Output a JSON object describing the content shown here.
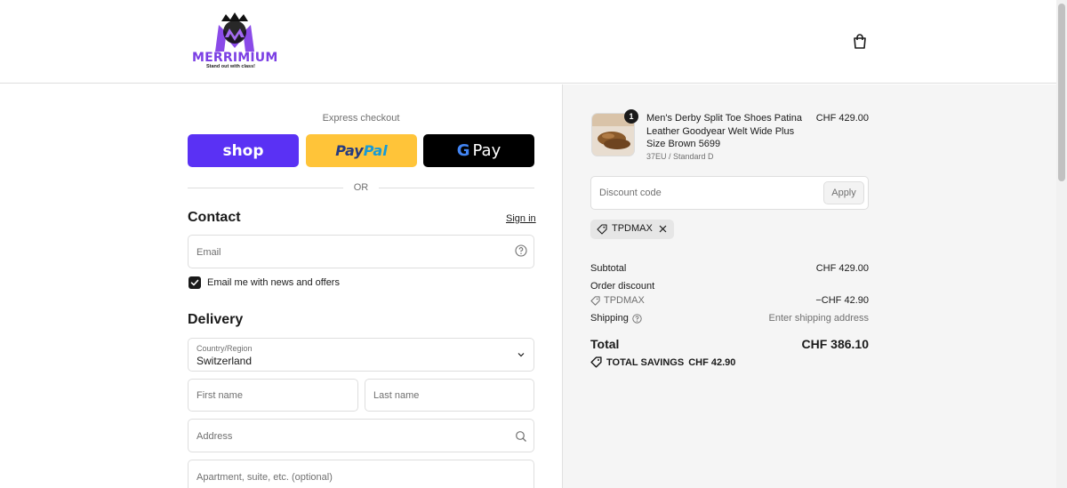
{
  "brand": {
    "name": "MERRIMIUM",
    "tagline": "Stand out with class!"
  },
  "express": {
    "label": "Express checkout",
    "shop_label": "shop",
    "paypal_part1": "Pay",
    "paypal_part2": "Pal",
    "gpay_g": "G",
    "gpay_label": "Pay",
    "or_label": "OR"
  },
  "contact": {
    "title": "Contact",
    "signin": "Sign in",
    "email_placeholder": "Email",
    "newsletter_label": "Email me with news and offers",
    "newsletter_checked": true
  },
  "delivery": {
    "title": "Delivery",
    "country_label": "Country/Region",
    "country_value": "Switzerland",
    "first_name_placeholder": "First name",
    "last_name_placeholder": "Last name",
    "address_placeholder": "Address",
    "apartment_placeholder": "Apartment, suite, etc. (optional)"
  },
  "summary": {
    "product": {
      "quantity": "1",
      "name": "Men's Derby Split Toe Shoes Patina Leather Goodyear Welt Wide Plus Size Brown 5699",
      "variant": "37EU / Standard D",
      "price": "CHF 429.00"
    },
    "discount_placeholder": "Discount code",
    "apply_label": "Apply",
    "applied_code": "TPDMAX",
    "subtotal_label": "Subtotal",
    "subtotal_value": "CHF 429.00",
    "order_discount_label": "Order discount",
    "order_discount_code": "TPDMAX",
    "order_discount_value": "−CHF 42.90",
    "shipping_label": "Shipping",
    "shipping_value": "Enter shipping address",
    "total_label": "Total",
    "total_value": "CHF 386.10",
    "savings_label": "TOTAL SAVINGS",
    "savings_value": "CHF 42.90"
  },
  "colors": {
    "shop": "#5a31f4",
    "paypal": "#ffc439",
    "gpay": "#000000",
    "brand": "#7b3fe4"
  }
}
